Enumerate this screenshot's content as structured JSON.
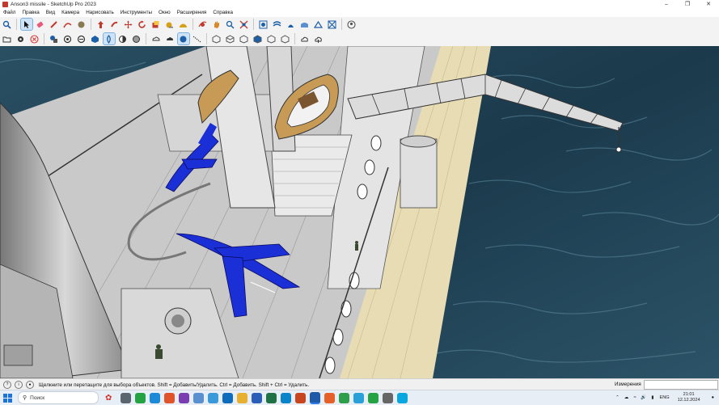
{
  "window": {
    "title": "Anson3 missile - SketchUp Pro 2023",
    "controls": [
      "–",
      "❐",
      "✕"
    ]
  },
  "menu": [
    "Файл",
    "Правка",
    "Вид",
    "Камера",
    "Нарисовать",
    "Инструменты",
    "Окно",
    "Расширения",
    "Справка"
  ],
  "toolbar1": {
    "tools": [
      "zoom-icon",
      "select-arrow-icon",
      "eraser-icon",
      "pencil-icon",
      "arc-icon",
      "paint-bucket-icon",
      "push-pull-icon",
      "follow-me-icon",
      "move-icon",
      "rotate-icon",
      "scale-icon",
      "tape-measure-icon",
      "protractor-icon",
      "orbit-icon",
      "pan-icon",
      "zoom-window-icon",
      "zoom-extents-icon",
      "sandbox-icon",
      "smoove-icon",
      "stamp-icon",
      "drape-icon",
      "add-detail-icon",
      "flip-edge-icon",
      "account-icon"
    ]
  },
  "toolbar2": {
    "tools": [
      "open-icon",
      "settings-icon",
      "close-circle-icon",
      "components-icon",
      "materials-icon",
      "styles-icon",
      "xray-icon",
      "back-edges-icon",
      "hidden-line-icon",
      "shaded-icon",
      "warehouse-icon",
      "extension-warehouse-icon",
      "layout-icon",
      "section-plane-icon",
      "iso-view-icon",
      "top-view-icon",
      "front-view-icon",
      "right-view-icon",
      "back-view-icon",
      "left-view-icon",
      "cloud-upload-icon",
      "cloud-download-icon"
    ]
  },
  "status": {
    "message": "Щелкните или перетащите для выбора объектов. Shift = Добавить/Удалить. Ctrl = Добавить. Shift + Ctrl = Удалить.",
    "measure_label": "Измерения",
    "measure_value": ""
  },
  "taskbar": {
    "search_placeholder": "Поиск",
    "apps": [
      {
        "name": "task-view-icon",
        "color": "#5a6570"
      },
      {
        "name": "whatsapp-icon",
        "color": "#25a244"
      },
      {
        "name": "edge-icon",
        "color": "#1c8ad6"
      },
      {
        "name": "brave-icon",
        "color": "#e0542b"
      },
      {
        "name": "onenote-icon",
        "color": "#7a3eb1"
      },
      {
        "name": "app-icon",
        "color": "#5a8fd0"
      },
      {
        "name": "paint-icon",
        "color": "#3a9ad9"
      },
      {
        "name": "outlook-icon",
        "color": "#0f6cbd"
      },
      {
        "name": "folder-icon",
        "color": "#e8b030"
      },
      {
        "name": "word-icon",
        "color": "#2b5eb8"
      },
      {
        "name": "excel-icon",
        "color": "#1f7244"
      },
      {
        "name": "edge-blue-icon",
        "color": "#0a84c8"
      },
      {
        "name": "powerpoint-icon",
        "color": "#c8461f"
      },
      {
        "name": "sketchup-icon",
        "color": "#1e5aa8"
      },
      {
        "name": "firefox-icon",
        "color": "#e6602a"
      },
      {
        "name": "chrome-icon",
        "color": "#2f9e4a"
      },
      {
        "name": "telegram-icon",
        "color": "#2aa0d8"
      },
      {
        "name": "whatsapp2-icon",
        "color": "#25a244"
      },
      {
        "name": "app2-icon",
        "color": "#666"
      },
      {
        "name": "skype-icon",
        "color": "#0aa6e0"
      }
    ],
    "language": "ENG",
    "time": "21:01",
    "date": "12.12.2024"
  }
}
